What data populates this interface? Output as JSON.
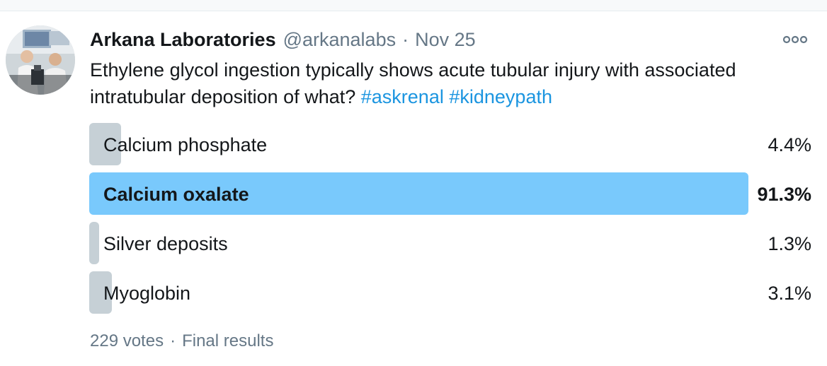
{
  "tweet": {
    "author": {
      "display_name": "Arkana Laboratories",
      "handle": "@arkanalabs"
    },
    "separator": "·",
    "date": "Nov 25",
    "text": "Ethylene glycol ingestion typically shows acute tubular injury with associated intratubular deposition of what?",
    "hashtags": [
      "#askrenal",
      "#kidneypath"
    ]
  },
  "more_button": {
    "icon": "more-horizontal-icon"
  },
  "poll": {
    "options": [
      {
        "label": "Calcium phosphate",
        "percent_label": "4.4%",
        "percent": 4.4,
        "winner": false
      },
      {
        "label": "Calcium oxalate",
        "percent_label": "91.3%",
        "percent": 91.3,
        "winner": true
      },
      {
        "label": "Silver deposits",
        "percent_label": "1.3%",
        "percent": 1.3,
        "winner": false
      },
      {
        "label": "Myoglobin",
        "percent_label": "3.1%",
        "percent": 3.1,
        "winner": false
      }
    ],
    "votes": "229 votes",
    "separator": "·",
    "status": "Final results"
  },
  "colors": {
    "text_primary": "#14171a",
    "text_secondary": "#657786",
    "hashtag": "#1b95e0",
    "bar_winner": "#79c9fc",
    "bar_other": "#c6d0d6"
  }
}
